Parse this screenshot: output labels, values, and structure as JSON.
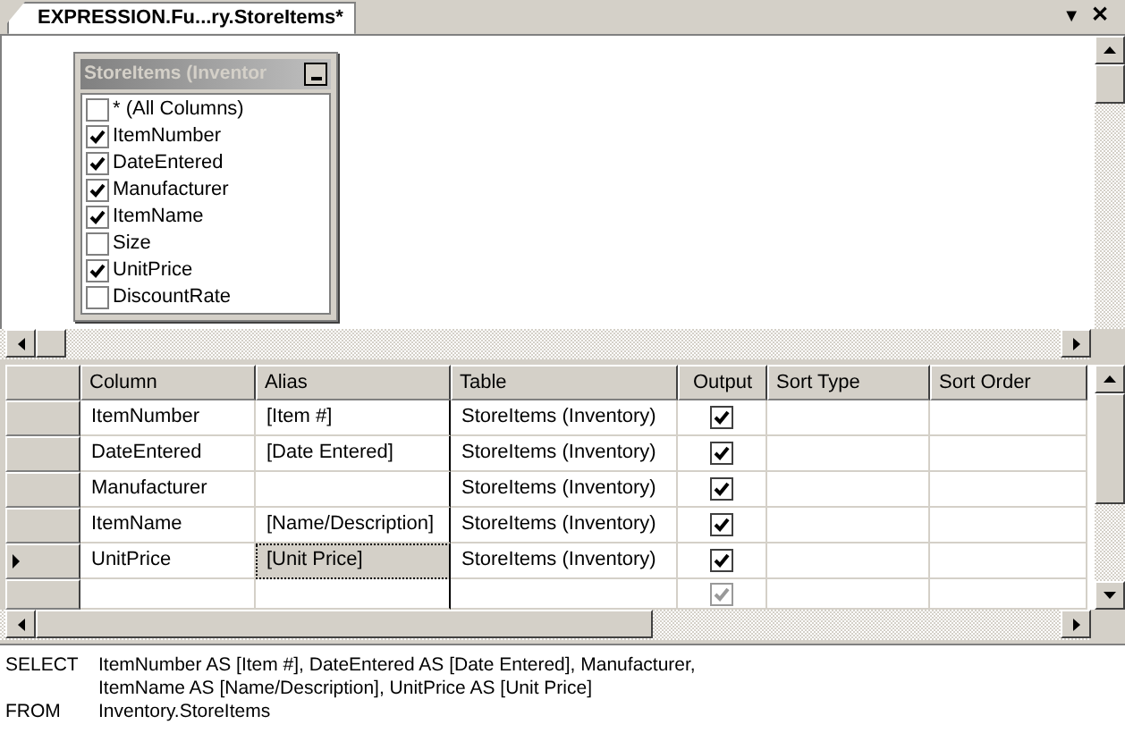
{
  "tab": {
    "title": "EXPRESSION.Fu...ry.StoreItems*",
    "dropdown": "▼",
    "close": "✕"
  },
  "diagram": {
    "table_title": "StoreItems (Inventor",
    "columns": [
      {
        "name": "* (All Columns)",
        "checked": false
      },
      {
        "name": "ItemNumber",
        "checked": true
      },
      {
        "name": "DateEntered",
        "checked": true
      },
      {
        "name": "Manufacturer",
        "checked": true
      },
      {
        "name": "ItemName",
        "checked": true
      },
      {
        "name": "Size",
        "checked": false
      },
      {
        "name": "UnitPrice",
        "checked": true
      },
      {
        "name": "DiscountRate",
        "checked": false
      }
    ]
  },
  "grid": {
    "headers": [
      "Column",
      "Alias",
      "Table",
      "Output",
      "Sort Type",
      "Sort Order"
    ],
    "rows": [
      {
        "column": "ItemNumber",
        "alias": "[Item #]",
        "table": "StoreItems (Inventory)",
        "output": true,
        "selected": false
      },
      {
        "column": "DateEntered",
        "alias": "[Date Entered]",
        "table": "StoreItems (Inventory)",
        "output": true,
        "selected": false
      },
      {
        "column": "Manufacturer",
        "table": "StoreItems (Inventory)",
        "output": true,
        "selected": false
      },
      {
        "column": "ItemName",
        "alias": "[Name/Description]",
        "table": "StoreItems (Inventory)",
        "output": true,
        "selected": false
      },
      {
        "column": "UnitPrice",
        "alias": "[Unit Price]",
        "table": "StoreItems (Inventory)",
        "output": true,
        "selected": true
      }
    ],
    "new_row": {
      "output": true
    }
  },
  "sql": [
    {
      "keyword": "SELECT",
      "lines": [
        "ItemNumber AS [Item #], DateEntered AS [Date Entered], Manufacturer,",
        "ItemName AS [Name/Description], UnitPrice AS [Unit Price]"
      ]
    },
    {
      "keyword": "FROM",
      "lines": [
        "Inventory.StoreItems"
      ]
    }
  ]
}
